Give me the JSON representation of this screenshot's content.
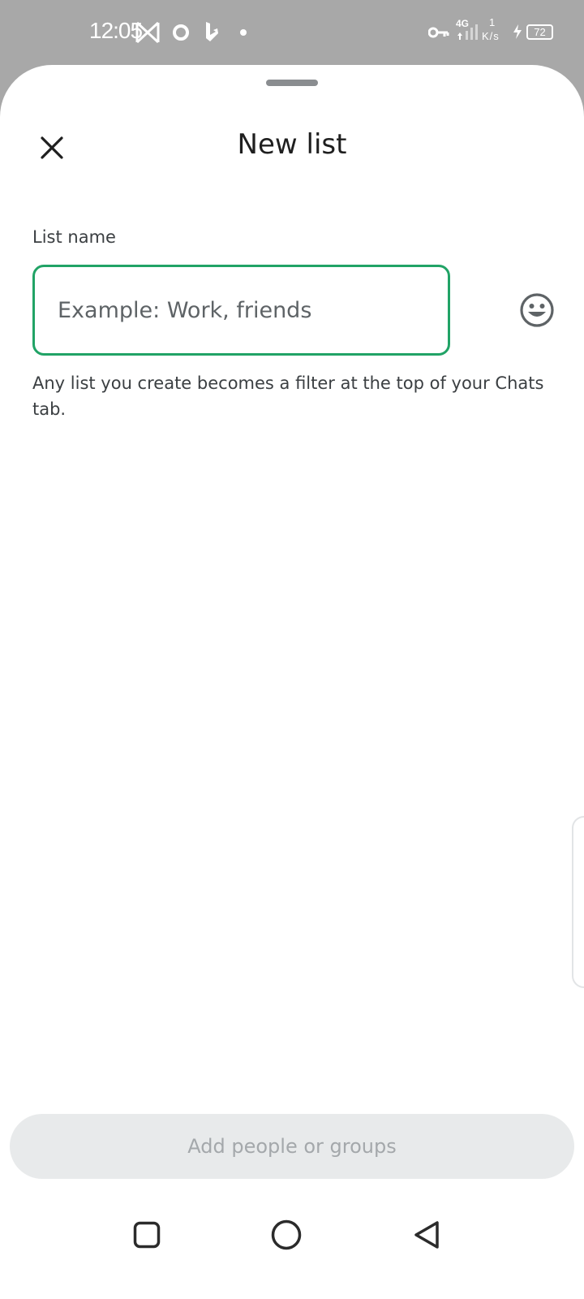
{
  "status_bar": {
    "time": "12:05",
    "network": "4G",
    "speed_value": "1",
    "speed_unit": "K/s",
    "battery": "72",
    "icons": [
      "notification-icon",
      "sync-icon",
      "bing-icon",
      "dot-icon",
      "vpn-key-icon",
      "signal-icon",
      "charging-icon",
      "battery-icon"
    ]
  },
  "sheet": {
    "title": "New list",
    "close_icon": "close-icon",
    "list_name_label": "List name",
    "list_name_placeholder": "Example: Work, friends",
    "list_name_value": "",
    "emoji_icon": "emoji-icon",
    "helper_text": "Any list you create becomes a filter at the top of your Chats tab.",
    "add_button_label": "Add people or groups"
  },
  "colors": {
    "accent": "#21a366",
    "status_bar_bg": "#a8a8a8",
    "sheet_bg": "#ffffff",
    "button_disabled_bg": "#e8eaeb",
    "button_disabled_text": "#a4a8ab"
  },
  "nav_bar": {
    "icons": [
      "recents-square-icon",
      "home-circle-icon",
      "back-triangle-icon"
    ]
  }
}
